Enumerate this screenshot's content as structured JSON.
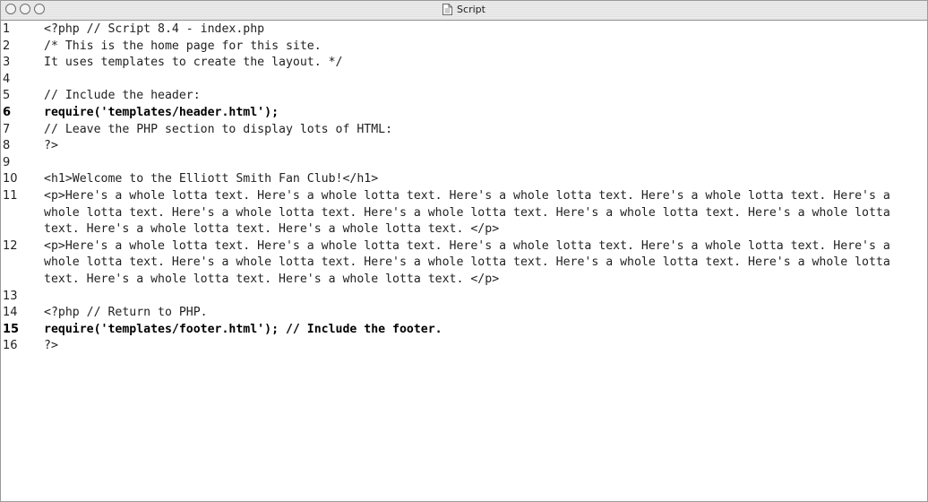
{
  "window": {
    "title": "Script",
    "icons": [
      "close-button",
      "minimize-button",
      "zoom-button",
      "document-icon"
    ]
  },
  "code": {
    "lines": [
      {
        "n": "1",
        "text": "<?php // Script 8.4 - index.php",
        "bold": false
      },
      {
        "n": "2",
        "text": "/* This is the home page for this site.",
        "bold": false
      },
      {
        "n": "3",
        "text": "It uses templates to create the layout. */",
        "bold": false
      },
      {
        "n": "4",
        "text": "",
        "bold": false
      },
      {
        "n": "5",
        "text": "// Include the header:",
        "bold": false
      },
      {
        "n": "6",
        "text": "require('templates/header.html');",
        "bold": true
      },
      {
        "n": "7",
        "text": "// Leave the PHP section to display lots of HTML:",
        "bold": false
      },
      {
        "n": "8",
        "text": "?>",
        "bold": false
      },
      {
        "n": "9",
        "text": "",
        "bold": false
      },
      {
        "n": "10",
        "text": "<h1>Welcome to the Elliott Smith Fan Club!</h1>",
        "bold": false
      },
      {
        "n": "11",
        "text": "<p>Here's a whole lotta text. Here's a whole lotta text. Here's a whole lotta text. Here's a whole lotta text. Here's a whole lotta text. Here's a whole lotta text. Here's a whole lotta text. Here's a whole lotta text. Here's a whole lotta text. Here's a whole lotta text. Here's a whole lotta text. </p>",
        "bold": false
      },
      {
        "n": "12",
        "text": "<p>Here's a whole lotta text. Here's a whole lotta text. Here's a whole lotta text. Here's a whole lotta text. Here's a whole lotta text. Here's a whole lotta text. Here's a whole lotta text. Here's a whole lotta text. Here's a whole lotta text. Here's a whole lotta text. Here's a whole lotta text. </p>",
        "bold": false
      },
      {
        "n": "13",
        "text": "",
        "bold": false
      },
      {
        "n": "14",
        "text": "<?php // Return to PHP.",
        "bold": false
      },
      {
        "n": "15",
        "text": "require('templates/footer.html'); // Include the footer.",
        "bold": true
      },
      {
        "n": "16",
        "text": "?>",
        "bold": false
      }
    ]
  }
}
